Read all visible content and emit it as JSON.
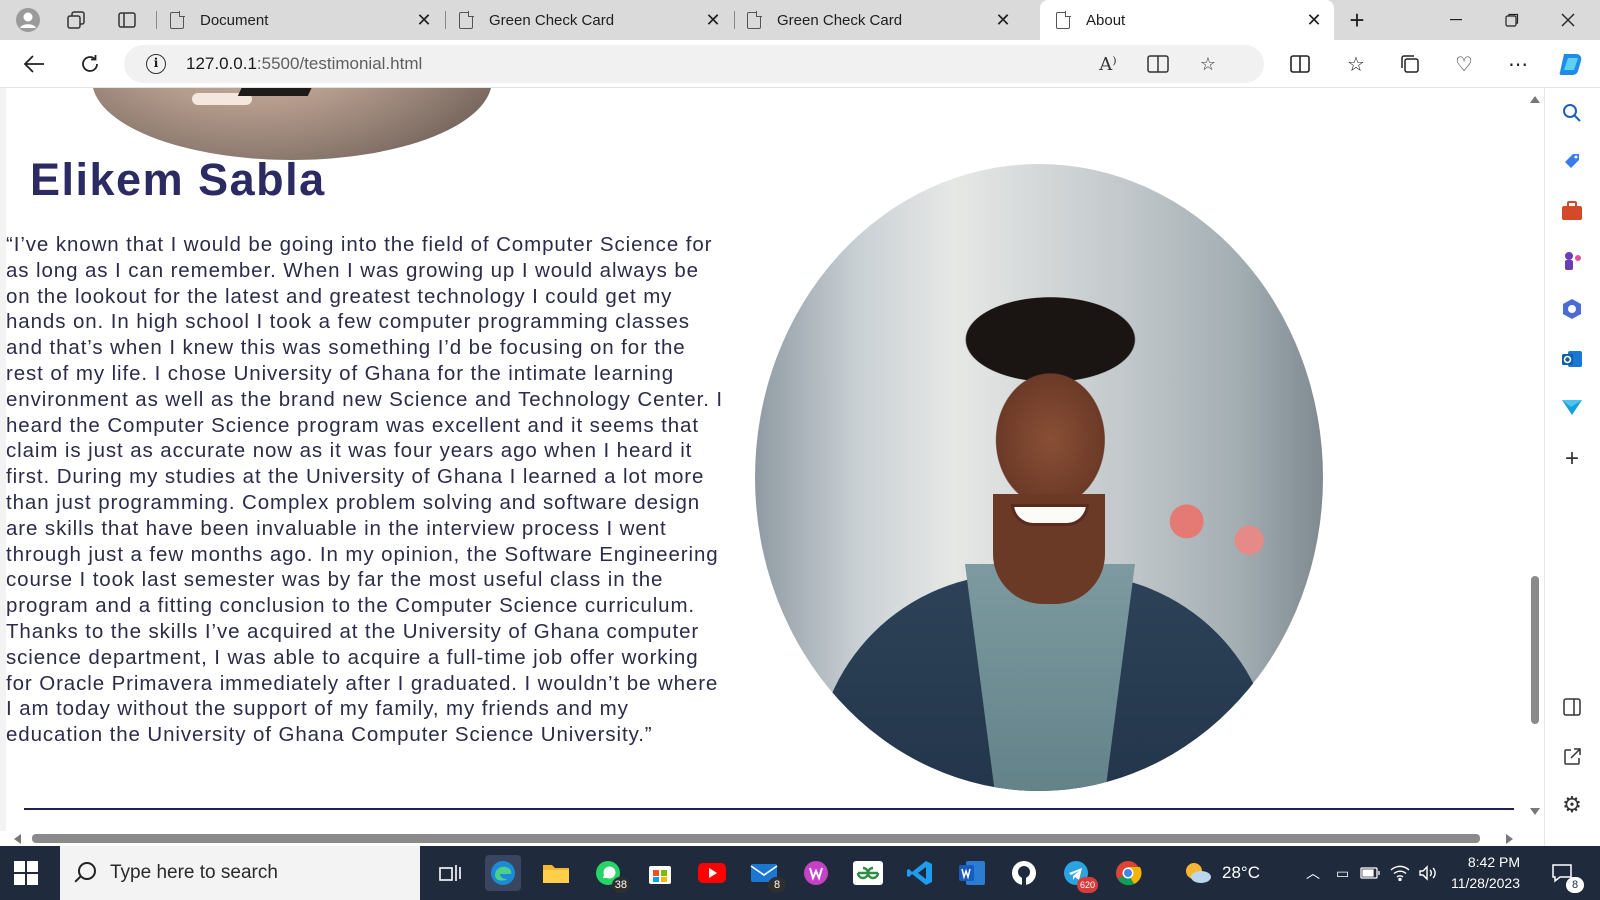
{
  "browser": {
    "tabs": [
      {
        "label": "Document",
        "active": false
      },
      {
        "label": "Green Check Card",
        "active": false
      },
      {
        "label": "Green Check Card",
        "active": false
      },
      {
        "label": "About",
        "active": true
      }
    ],
    "new_tab": "+",
    "url_host": "127.0.0.1",
    "url_path": ":5500/testimonial.html"
  },
  "page": {
    "name": "Elikem Sabla",
    "quote": "“I’ve known that I would be going into the field of Computer Science for as long as I can remember. When I was growing up I would always be on the lookout for the latest and greatest technology I could get my hands on. In high school I took a few computer programming classes and that’s when I knew this was something I’d be focusing on for the rest of my life. I chose University of Ghana for the intimate learning environment as well as the brand new Science and Technology Center. I heard the Computer Science program was excellent and it seems that claim is just as accurate now as it was four years ago when I heard it first. During my studies at the University of Ghana I learned a lot more than just programming. Complex problem solving and software design are skills that have been invaluable in the interview process I went through just a few months ago. In my opinion, the Software Engineering course I took last semester was by far the most useful class in the program and a fitting conclusion to the Computer Science curriculum. Thanks to the skills I’ve acquired at the University of Ghana computer science department, I was able to acquire a full-time job offer working for Oracle Primavera immediately after I graduated. I wouldn’t be where I am today without the support of my family, my friends and my education the University of Ghana Computer Science University.”"
  },
  "taskbar": {
    "search_placeholder": "Type here to search",
    "whatsapp_badge": "38",
    "mail_badge": "8",
    "telegram_badge": "620",
    "weather": "28°C",
    "time": "8:42 PM",
    "date": "11/28/2023",
    "notifications": "8"
  },
  "colors": {
    "name_color": "#2b2a63",
    "taskbar_bg": "#1f2a3c",
    "tabstrip_bg": "#dadada"
  }
}
